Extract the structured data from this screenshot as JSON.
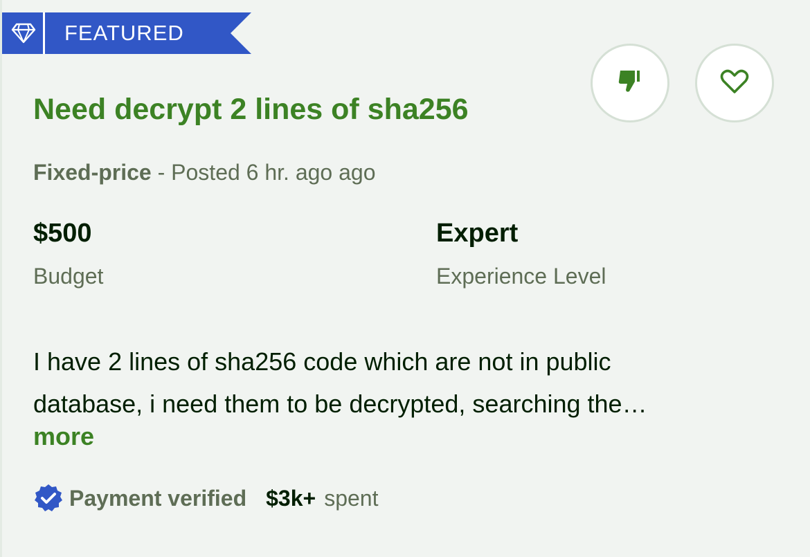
{
  "ribbon": {
    "label": "FEATURED",
    "icon": "diamond-icon",
    "color": "#3157c6"
  },
  "job": {
    "title": "Need decrypt 2 lines of sha256",
    "job_type": "Fixed-price",
    "separator": " - ",
    "posted": "Posted 6 hr. ago ago",
    "budget_value": "$500",
    "budget_label": "Budget",
    "experience_value": "Expert",
    "experience_label": "Experience Level",
    "description_line1": "I have 2 lines of sha256 code which are not in public",
    "description_line2": "database, i need them to be decrypted, searching the…",
    "more_label": "more"
  },
  "actions": {
    "dislike_icon": "thumbs-down-icon",
    "save_icon": "heart-icon"
  },
  "client": {
    "verified_icon": "verified-badge-icon",
    "payment_status": "Payment verified",
    "spent_amount": "$3k+",
    "spent_label": "spent"
  },
  "colors": {
    "accent_green": "#3c8224",
    "ribbon_blue": "#3157c6",
    "text_dark": "#001e00",
    "text_muted": "#5e6d55",
    "background": "#f1f4f1"
  }
}
